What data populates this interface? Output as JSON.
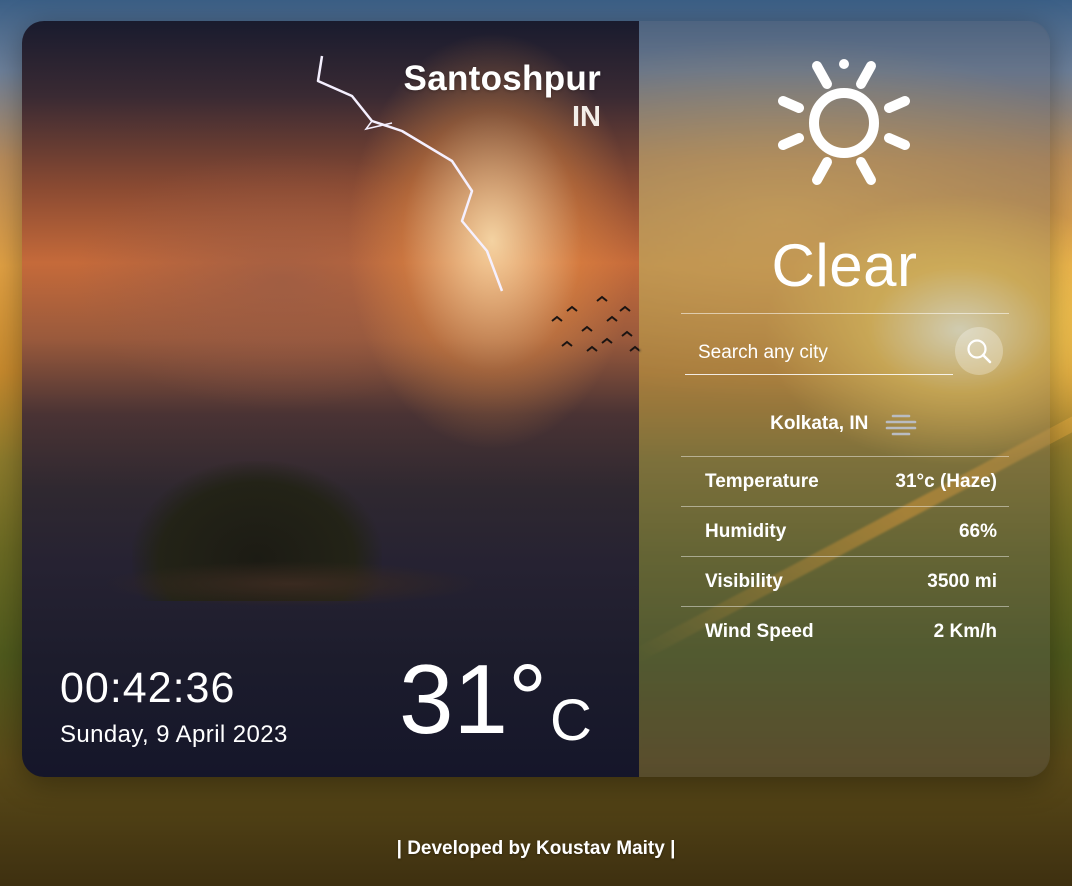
{
  "location": {
    "city": "Santoshpur",
    "country": "IN"
  },
  "clock": {
    "time": "00:42:36",
    "date": "Sunday, 9 April 2023"
  },
  "temperature": {
    "value": "31°",
    "unit": "C"
  },
  "weather": {
    "condition": "Clear",
    "icon": "sun-icon"
  },
  "search": {
    "placeholder": "Search any city",
    "icon": "search-icon"
  },
  "current_location": {
    "label": "Kolkata, IN",
    "icon": "haze-icon"
  },
  "stats": [
    {
      "label": "Temperature",
      "value": "31°c (Haze)"
    },
    {
      "label": "Humidity",
      "value": "66%"
    },
    {
      "label": "Visibility",
      "value": "3500 mi"
    },
    {
      "label": "Wind Speed",
      "value": "2 Km/h"
    }
  ],
  "footer": {
    "credit": "| Developed by Koustav Maity |"
  }
}
